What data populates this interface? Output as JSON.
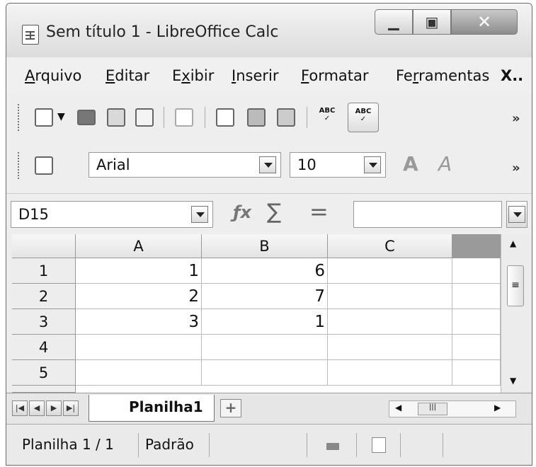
{
  "window": {
    "title": "Sem título 1 - LibreOffice Calc"
  },
  "menu": {
    "items": [
      {
        "key": "A",
        "rest": "rquivo"
      },
      {
        "key": "E",
        "rest": "ditar"
      },
      {
        "pre": "E",
        "key": "x",
        "rest": "ibir"
      },
      {
        "key": "I",
        "rest": "nserir"
      },
      {
        "key": "F",
        "rest": "ormatar"
      },
      {
        "pre": "Fe",
        "key": "r",
        "rest": "ramentas"
      }
    ],
    "overflow": "X.."
  },
  "toolbar": {
    "overflow": "»",
    "icons": [
      "new-document-icon",
      "open-folder-icon",
      "save-icon",
      "email-icon",
      "edit-file-icon",
      "export-pdf-icon",
      "print-icon",
      "print-preview-icon",
      "spellcheck-icon",
      "autospellcheck-icon"
    ]
  },
  "format": {
    "font_name": "Arial",
    "font_size": "10",
    "overflow": "»"
  },
  "formula": {
    "name_box": "D15",
    "sigma": "∑",
    "equals": "=",
    "content": ""
  },
  "sheet": {
    "columns": [
      "A",
      "B",
      "C"
    ],
    "rows": [
      {
        "label": "1",
        "a": "1",
        "b": "6",
        "c": ""
      },
      {
        "label": "2",
        "a": "2",
        "b": "7",
        "c": ""
      },
      {
        "label": "3",
        "a": "3",
        "b": "1",
        "c": ""
      },
      {
        "label": "4",
        "a": "",
        "b": "",
        "c": ""
      },
      {
        "label": "5",
        "a": "",
        "b": "",
        "c": ""
      }
    ]
  },
  "tabs": {
    "sheet_name": "Planilha1",
    "add": "+"
  },
  "status": {
    "sheet_pos": "Planilha 1 / 1",
    "style": "Padrão"
  }
}
